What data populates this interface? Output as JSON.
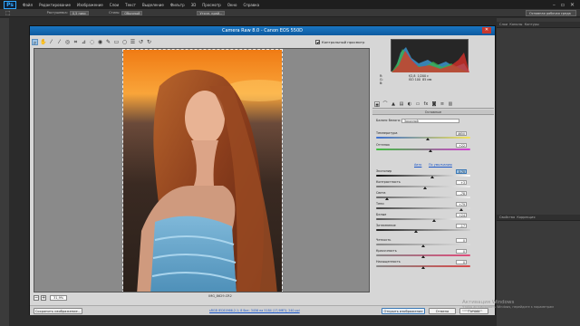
{
  "ps": {
    "menu": [
      "Файл",
      "Редактирование",
      "Изображение",
      "Слои",
      "Текст",
      "Выделение",
      "Фильтр",
      "3D",
      "Просмотр",
      "Окно",
      "Справка"
    ],
    "options": [
      "Растушевка:",
      "Стиль:",
      "Уточн. край..."
    ],
    "options_values": [
      "0,5 пикс",
      "Обычный"
    ],
    "workspace": "Основная рабочая среда",
    "right_tabs": [
      "Слои",
      "Каналы",
      "Контуры"
    ],
    "right_tabs2": [
      "Свойства",
      "Коррекция"
    ]
  },
  "dialog": {
    "title": "Camera Raw 8.0  -  Canon EOS 550D",
    "preview_label": "Контрольный просмотр",
    "zoom": "31,9%",
    "filename": "IMG_8629.CR2",
    "workflow_link": "sRGB IEC61966-2.1; 8 бит; 3456 на 5184 (17,9МП); 240 ppi",
    "buttons": {
      "save": "Сохранить изображение...",
      "open": "Открыть изображение",
      "cancel": "Отмена",
      "done": "Готово"
    }
  },
  "histogram": {
    "meta_left": [
      "R:",
      "G:",
      "B:"
    ],
    "meta_right": [
      "f/2,8",
      "1/200 с",
      "ISO 100",
      "85 мм"
    ]
  },
  "panel": {
    "section": "Основные",
    "white_balance_label": "Баланс белого:",
    "white_balance_value": "Заказной",
    "auto_link": "Авто",
    "default_link": "По умолчанию",
    "sliders": [
      {
        "label": "Температура",
        "value": "4650",
        "pos": 0.55
      },
      {
        "label": "Оттенок",
        "value": "+22",
        "pos": 0.58
      },
      {
        "label": "Экспонир",
        "value": "0,70",
        "pos": 0.6
      },
      {
        "label": "Контрастность",
        "value": "+3",
        "pos": 0.52
      },
      {
        "label": "Света",
        "value": "-78",
        "pos": 0.12
      },
      {
        "label": "Тени",
        "value": "+79",
        "pos": 0.9
      },
      {
        "label": "Белые",
        "value": "+24",
        "pos": 0.62
      },
      {
        "label": "Затемнение",
        "value": "-17",
        "pos": 0.42
      },
      {
        "label": "Четкость",
        "value": "0",
        "pos": 0.5
      },
      {
        "label": "Красочность",
        "value": "0",
        "pos": 0.5
      },
      {
        "label": "Насыщенность",
        "value": "0",
        "pos": 0.5
      }
    ]
  },
  "activation": {
    "title": "Активация Windows",
    "text": "Чтобы активировать Windows, перейдите к параметрам компьютера."
  },
  "colors": {
    "accent": "#1a76c2",
    "ps_bg": "#2b2b2b",
    "dialog_bg": "#d6d6d6"
  }
}
